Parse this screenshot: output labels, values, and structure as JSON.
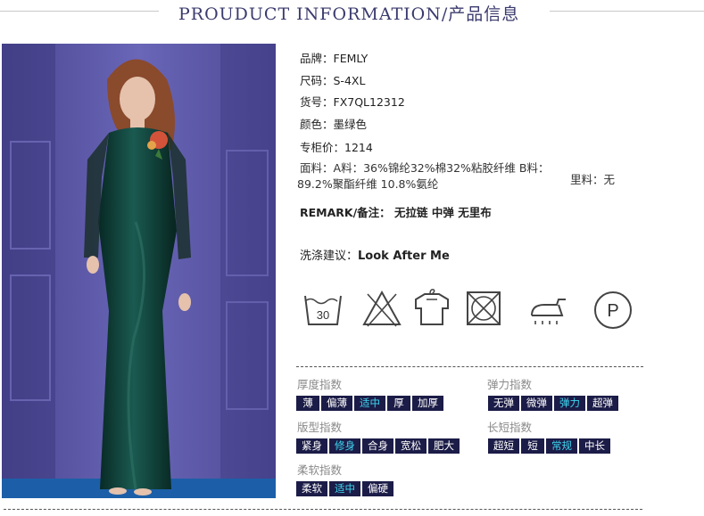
{
  "header": {
    "title": "PROUDUCT INFORMATION/产品信息"
  },
  "product": {
    "brand": "品牌：FEMLY",
    "size": "尺码：S-4XL",
    "sku": "货号：FX7QL12312",
    "color": "颜色：墨绿色",
    "price": "专柜价：1214",
    "fabric_label": "面料：",
    "fabric_value": "A料：36%锦纶32%棉32%粘胶纤维 B料： 89.2%聚酯纤维 10.8%氨纶",
    "lining": "里料：无",
    "remark": "REMARK/备注： 无拉链 中弹 无里布",
    "care_label": "洗涤建议：",
    "care_value": "Look After Me"
  },
  "care_icons": [
    {
      "icon": "wash-30-icon",
      "text": "30"
    },
    {
      "icon": "no-bleach-icon"
    },
    {
      "icon": "hang-dry-icon"
    },
    {
      "icon": "no-tumble-dry-icon"
    },
    {
      "icon": "iron-low-icon"
    },
    {
      "icon": "dry-clean-p-icon",
      "text": "P"
    }
  ],
  "indices": {
    "thickness": {
      "title": "厚度指数",
      "options": [
        "薄",
        "偏薄",
        "适中",
        "厚",
        "加厚"
      ],
      "selected": "适中"
    },
    "elasticity": {
      "title": "弹力指数",
      "options": [
        "无弹",
        "微弹",
        "弹力",
        "超弹"
      ],
      "selected": "弹力"
    },
    "fit": {
      "title": "版型指数",
      "options": [
        "紧身",
        "修身",
        "合身",
        "宽松",
        "肥大"
      ],
      "selected": "修身"
    },
    "length": {
      "title": "长短指数",
      "options": [
        "超短",
        "短",
        "常规",
        "中长"
      ],
      "selected": "常规"
    },
    "softness": {
      "title": "柔软指数",
      "options": [
        "柔软",
        "适中",
        "偏硬"
      ],
      "selected": "适中"
    }
  },
  "colors": {
    "chip_bg": "#1c1c48",
    "chip_selected_text": "#3ed6ef",
    "header_text": "#3a3a6e",
    "dress": "#0f3a34",
    "backdrop": "#5c57a8"
  }
}
